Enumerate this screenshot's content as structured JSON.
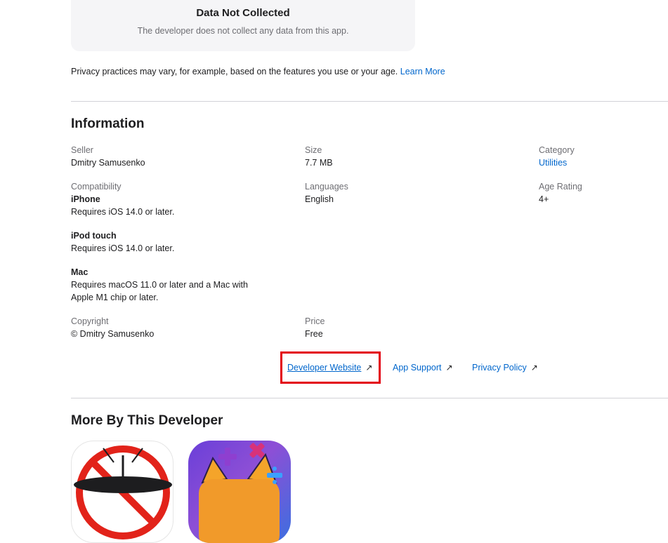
{
  "privacy_card": {
    "title": "Data Not Collected",
    "description": "The developer does not collect any data from this app."
  },
  "privacy_note": {
    "text": "Privacy practices may vary, for example, based on the features you use or your age. ",
    "link": "Learn More"
  },
  "information": {
    "title": "Information",
    "seller": {
      "label": "Seller",
      "value": "Dmitry Samusenko"
    },
    "size": {
      "label": "Size",
      "value": "7.7 MB"
    },
    "category": {
      "label": "Category",
      "value": "Utilities"
    },
    "compatibility": {
      "label": "Compatibility",
      "devices": [
        {
          "name": "iPhone",
          "requirement": "Requires iOS 14.0 or later."
        },
        {
          "name": "iPod touch",
          "requirement": "Requires iOS 14.0 or later."
        },
        {
          "name": "Mac",
          "requirement_line1": "Requires macOS 11.0 or later and a Mac with",
          "requirement_line2": "Apple M1 chip or later."
        }
      ]
    },
    "languages": {
      "label": "Languages",
      "value": "English"
    },
    "age_rating": {
      "label": "Age Rating",
      "value": "4+"
    },
    "copyright": {
      "label": "Copyright",
      "value": "© Dmitry Samusenko"
    },
    "price": {
      "label": "Price",
      "value": "Free"
    }
  },
  "links": {
    "developer_website": "Developer Website",
    "app_support": "App Support",
    "privacy_policy": "Privacy Policy",
    "arrow_icon": "↗"
  },
  "more_by_developer": {
    "title": "More By This Developer"
  },
  "colors": {
    "link": "#0066cc",
    "highlight": "#e3000f",
    "card_bg": "#f5f5f7"
  }
}
